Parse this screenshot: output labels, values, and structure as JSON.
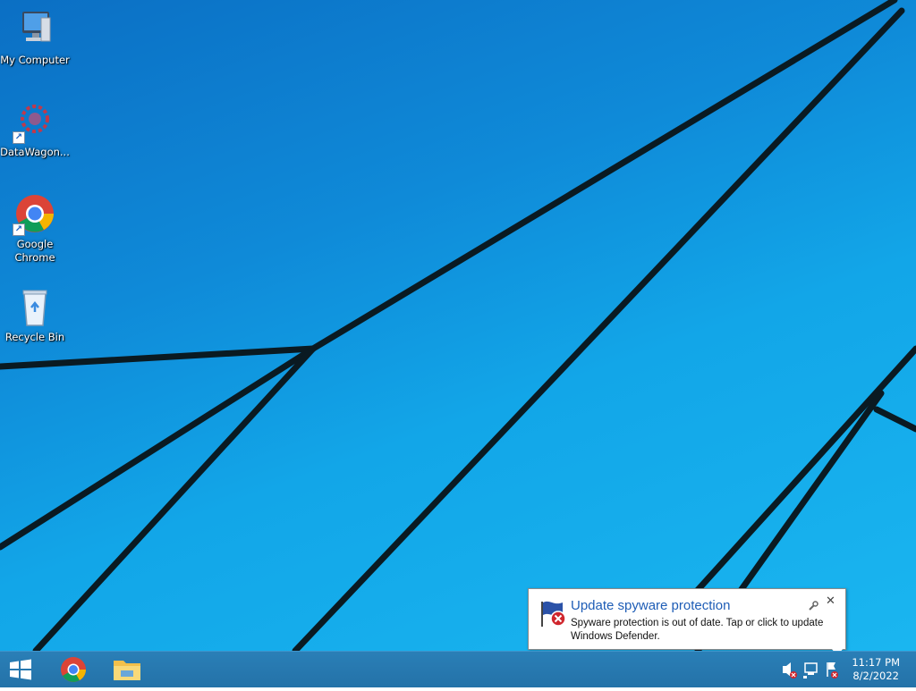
{
  "desktop": {
    "icons": [
      {
        "label": "My Computer",
        "icon": "computer-icon"
      },
      {
        "label": "DataWagon...",
        "icon": "datawagon-icon"
      },
      {
        "label": "Google Chrome",
        "icon": "chrome-icon"
      },
      {
        "label": "Recycle Bin",
        "icon": "recycle-bin-icon"
      }
    ]
  },
  "notification": {
    "title": "Update spyware protection",
    "body": "Spyware protection is out of date. Tap or click to update Windows Defender.",
    "icon": "defender-flag-error-icon"
  },
  "taskbar": {
    "apps": [
      {
        "name": "Google Chrome",
        "icon": "chrome-icon"
      },
      {
        "name": "File Explorer",
        "icon": "folder-icon"
      }
    ],
    "tray": {
      "time": "11:17 PM",
      "date": "8/2/2022"
    }
  },
  "colors": {
    "accent": "#1e5db6",
    "taskbar": "#2472a8",
    "wallpaper": "#12a6e8"
  }
}
